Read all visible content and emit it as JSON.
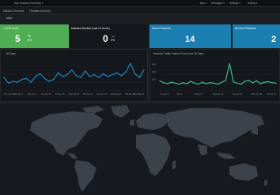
{
  "topbar": {
    "app_title": "App: Malware Summary ▾",
    "menu": [
      "Jack ▾",
      "Messages ▾",
      "Settings ▾",
      "Activity ▾"
    ]
  },
  "subnav": {
    "tabs": [
      "Malware Overview",
      "Firewalls Summary"
    ]
  },
  "section": {
    "label": "ware"
  },
  "kpis": [
    {
      "title": "...ed 24 Hours",
      "value": "5",
      "arrow": "↘",
      "pct": "-8%",
      "bg": "#4fae53",
      "fg": "#ffffff"
    },
    {
      "title": "Malware Blocked (Last 24 Hours)",
      "value": "0",
      "arrow": "→",
      "pct": "0%",
      "bg": "#14171b",
      "fg": "#ffffff"
    },
    {
      "title": "Users Protected",
      "value": "14",
      "bg": "#1b7eb0",
      "fg": "#ffffff"
    },
    {
      "title": "Devices Protected",
      "value": "2",
      "bg": "#1b7eb0",
      "fg": "#ffffff"
    }
  ],
  "chart_data": [
    {
      "type": "line",
      "title": "...30 Days",
      "color": "#1f8fd6",
      "x_tick_labels": [
        "Sun Jun 3",
        "Wed Apr 6",
        "Sat Apr 9",
        "Tue Apr 12",
        "Fri Apr 15",
        "Mon Apr 18",
        "Thu Apr 21",
        "Sun Apr 24",
        "Wed Apr 27",
        "Sat Apr 30",
        "Tue May 3"
      ],
      "values": [
        14,
        8,
        10,
        9,
        12,
        13,
        9,
        15,
        18,
        13,
        10,
        12,
        19,
        15,
        17,
        22,
        16,
        14,
        21,
        15,
        17,
        14,
        18,
        15,
        17,
        19,
        16,
        20,
        29,
        18,
        14,
        22
      ],
      "ylim": [
        0,
        35
      ],
      "grid": true
    },
    {
      "type": "line",
      "title": "Network Traffic Volume Trend over 30 Days",
      "color": "#40c98f",
      "y_tick_labels": [
        "60K",
        "40K",
        "20K"
      ],
      "x_tick_labels": [
        "Tue Apr 5",
        "Apr 6",
        "Sat Apr 9",
        "Wed Apr 13",
        "Thu Apr 14",
        "Mon Apr 18",
        "Fri Apr 22"
      ],
      "values": [
        21,
        17,
        15,
        18,
        16,
        14,
        17,
        15,
        20,
        16,
        14,
        18,
        15,
        17,
        16,
        14,
        18,
        22,
        57,
        19,
        16,
        14,
        20,
        22,
        17,
        21,
        15,
        18,
        19,
        17,
        16
      ],
      "ylim": [
        0,
        70
      ],
      "grid": true
    }
  ]
}
